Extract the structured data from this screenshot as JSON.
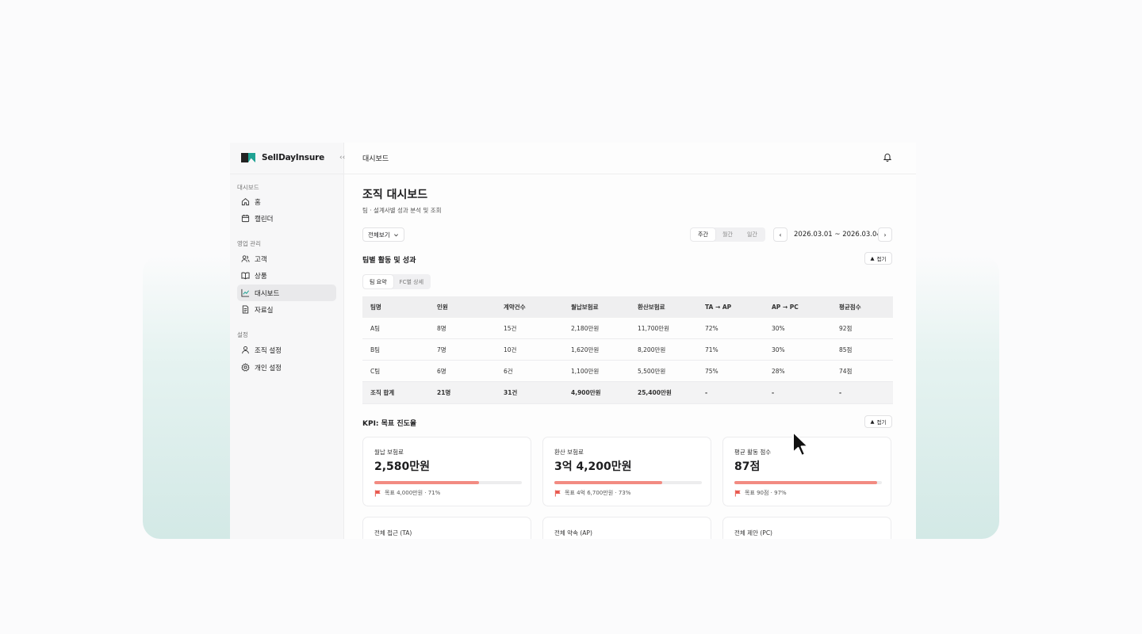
{
  "app": {
    "name": "SellDayInsure",
    "collapse_icon": "double-chevron-left-icon"
  },
  "sidebar": {
    "sections": [
      {
        "label": "대시보드",
        "items": [
          {
            "label": "홈",
            "icon": "home-icon"
          },
          {
            "label": "캘린더",
            "icon": "calendar-icon"
          }
        ]
      },
      {
        "label": "영업 관리",
        "items": [
          {
            "label": "고객",
            "icon": "users-icon"
          },
          {
            "label": "상품",
            "icon": "book-icon"
          },
          {
            "label": "대시보드",
            "icon": "chart-line-icon",
            "active": true
          },
          {
            "label": "자료실",
            "icon": "document-icon"
          }
        ]
      },
      {
        "label": "설정",
        "items": [
          {
            "label": "조직 설정",
            "icon": "user-icon"
          },
          {
            "label": "개인 설정",
            "icon": "gear-icon"
          }
        ]
      }
    ]
  },
  "topbar": {
    "title": "대시보드",
    "bell_icon": "bell-icon"
  },
  "page": {
    "title": "조직 대시보드",
    "subtitle": "팀 · 설계사별 성과 분석 및 조회",
    "view_select": "전체보기",
    "period_tabs": [
      "주간",
      "월간",
      "일간"
    ],
    "period_selected": "주간",
    "date_range": "2026.03.01 ~ 2026.03.04"
  },
  "team_section": {
    "title": "팀별 활동 및 성과",
    "fold_label": "접기",
    "tabs": [
      "팀 요약",
      "FC별 상세"
    ],
    "tab_selected": "팀 요약",
    "columns": [
      "팀명",
      "인원",
      "계약건수",
      "월납보험료",
      "환산보험료",
      "TA → AP",
      "AP → PC",
      "평균점수"
    ],
    "rows": [
      [
        "A팀",
        "8명",
        "15건",
        "2,180만원",
        "11,700만원",
        "72%",
        "30%",
        "92점"
      ],
      [
        "B팀",
        "7명",
        "10건",
        "1,620만원",
        "8,200만원",
        "71%",
        "30%",
        "85점"
      ],
      [
        "C팀",
        "6명",
        "6건",
        "1,100만원",
        "5,500만원",
        "75%",
        "28%",
        "74점"
      ]
    ],
    "total": [
      "조직 합계",
      "21명",
      "31건",
      "4,900만원",
      "25,400만원",
      "-",
      "-",
      "-"
    ]
  },
  "kpi_section": {
    "title": "KPI: 목표 진도율",
    "fold_label": "접기",
    "accent_color": "#f28b82",
    "cards": [
      {
        "label": "월납 보험료",
        "value": "2,580만원",
        "progress": 0.71,
        "goal": "목표 4,000만원 · 71%"
      },
      {
        "label": "환산 보험료",
        "value": "3억 4,200만원",
        "progress": 0.73,
        "goal": "목표 4억 6,700만원 · 73%"
      },
      {
        "label": "평균 활동 점수",
        "value": "87점",
        "progress": 0.97,
        "goal": "목표 90점 · 97%"
      }
    ],
    "cards_row2": [
      {
        "label": "전체 접근 (TA)"
      },
      {
        "label": "전체 약속 (AP)"
      },
      {
        "label": "전체 제안 (PC)"
      }
    ]
  }
}
